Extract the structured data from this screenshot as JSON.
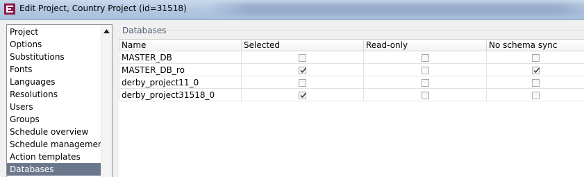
{
  "window": {
    "title": "Edit Project, Country Project (id=31518)",
    "icon": "firstspirit-app-icon"
  },
  "sidebar": {
    "items": [
      {
        "label": "Project",
        "selected": false
      },
      {
        "label": "Options",
        "selected": false
      },
      {
        "label": "Substitutions",
        "selected": false
      },
      {
        "label": "Fonts",
        "selected": false
      },
      {
        "label": "Languages",
        "selected": false
      },
      {
        "label": "Resolutions",
        "selected": false
      },
      {
        "label": "Users",
        "selected": false
      },
      {
        "label": "Groups",
        "selected": false
      },
      {
        "label": "Schedule overview",
        "selected": false
      },
      {
        "label": "Schedule management",
        "selected": false
      },
      {
        "label": "Action templates",
        "selected": false
      },
      {
        "label": "Databases",
        "selected": true
      }
    ]
  },
  "section": {
    "title": "Databases"
  },
  "table": {
    "columns": [
      "Name",
      "Selected",
      "Read-only",
      "No schema sync"
    ],
    "rows": [
      {
        "name": "MASTER_DB",
        "selected": false,
        "read_only": false,
        "no_schema_sync": false
      },
      {
        "name": "MASTER_DB_ro",
        "selected": true,
        "read_only": false,
        "no_schema_sync": true
      },
      {
        "name": "derby_project11_0",
        "selected": false,
        "read_only": false,
        "no_schema_sync": false
      },
      {
        "name": "derby_project31518_0",
        "selected": true,
        "read_only": false,
        "no_schema_sync": false
      }
    ]
  },
  "colors": {
    "selection": "#6b778c",
    "group_label": "#4d5c73"
  }
}
